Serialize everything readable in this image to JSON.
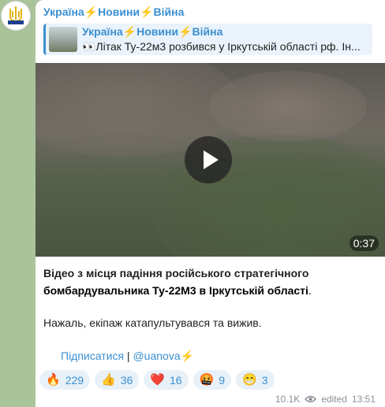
{
  "channel": {
    "name": "Україна⚡Новини⚡Війна"
  },
  "reply": {
    "title": "Україна⚡Новини⚡Війна",
    "preview": "👀Літак Ту-22м3 розбився у Іркутській області рф. Ін..."
  },
  "video": {
    "duration": "0:37"
  },
  "message": {
    "line1": "Відео з місця падіння російського стратегічного",
    "line2_bold": "бомбардувальника Ту-22М3 в Іркутській області",
    "line2_end": ".",
    "line3": "Нажаль, екіпаж катапультувався та вижив.",
    "subscribe_link": "Підписатися",
    "separator": " | ",
    "handle_link": "@uanova",
    "handle_suffix": "⚡"
  },
  "reactions": [
    {
      "emoji": "🔥",
      "count": "229"
    },
    {
      "emoji": "👍",
      "count": "36"
    },
    {
      "emoji": "❤️",
      "count": "16"
    },
    {
      "emoji": "🤬",
      "count": "9"
    },
    {
      "emoji": "😁",
      "count": "3"
    }
  ],
  "meta": {
    "views": "10.1K",
    "edited": "edited",
    "time": "13:51"
  },
  "colors": {
    "accent": "#3a8fd0",
    "background": "#a9c39a"
  }
}
